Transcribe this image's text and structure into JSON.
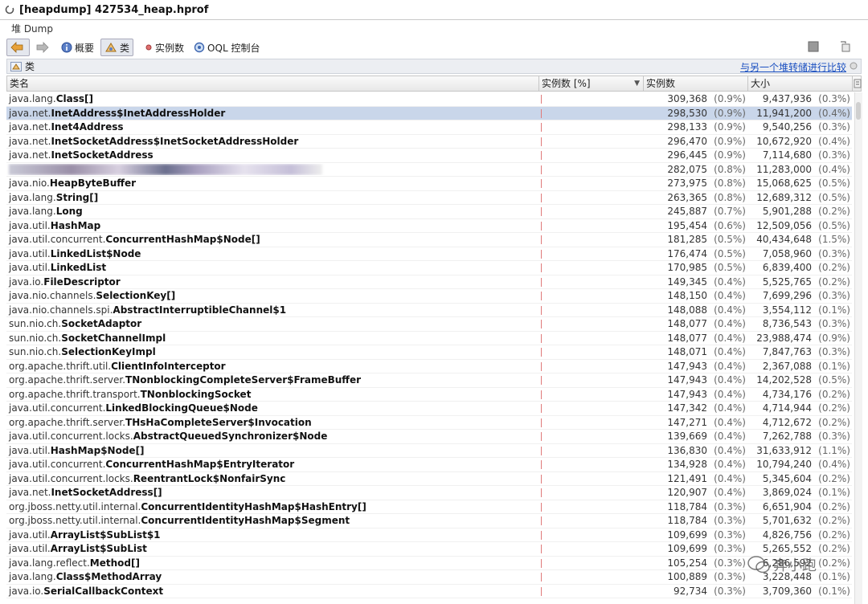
{
  "window": {
    "title": "[heapdump] 427534_heap.hprof"
  },
  "subtab": {
    "label": "堆 Dump"
  },
  "toolbar": {
    "summary_label": "概要",
    "classes_label": "类",
    "instances_label": "实例数",
    "oql_label": "OQL 控制台"
  },
  "section": {
    "title": "类",
    "compare_link": "与另一个堆转储进行比较"
  },
  "columns": {
    "name": "类名",
    "instances_pct": "实例数 [%]",
    "instances": "实例数",
    "size": "大小"
  },
  "watermark": {
    "text": "奔小跑"
  },
  "rows": [
    {
      "pkg": "java.lang.",
      "cls": "Class[]",
      "count": "309,368",
      "cpct": "(0.9%)",
      "size": "9,437,936",
      "spct": "(0.3%)"
    },
    {
      "pkg": "java.net.",
      "cls": "InetAddress$InetAddressHolder",
      "count": "298,530",
      "cpct": "(0.9%)",
      "size": "11,941,200",
      "spct": "(0.4%)",
      "selected": true
    },
    {
      "pkg": "java.net.",
      "cls": "Inet4Address",
      "count": "298,133",
      "cpct": "(0.9%)",
      "size": "9,540,256",
      "spct": "(0.3%)"
    },
    {
      "pkg": "java.net.",
      "cls": "InetSocketAddress$InetSocketAddressHolder",
      "count": "296,470",
      "cpct": "(0.9%)",
      "size": "10,672,920",
      "spct": "(0.4%)"
    },
    {
      "pkg": "java.net.",
      "cls": "InetSocketAddress",
      "count": "296,445",
      "cpct": "(0.9%)",
      "size": "7,114,680",
      "spct": "(0.3%)"
    },
    {
      "pkg": "",
      "cls": "",
      "count": "282,075",
      "cpct": "(0.8%)",
      "size": "11,283,000",
      "spct": "(0.4%)",
      "blurred": true
    },
    {
      "pkg": "java.nio.",
      "cls": "HeapByteBuffer",
      "count": "273,975",
      "cpct": "(0.8%)",
      "size": "15,068,625",
      "spct": "(0.5%)"
    },
    {
      "pkg": "java.lang.",
      "cls": "String[]",
      "count": "263,365",
      "cpct": "(0.8%)",
      "size": "12,689,312",
      "spct": "(0.5%)"
    },
    {
      "pkg": "java.lang.",
      "cls": "Long",
      "count": "245,887",
      "cpct": "(0.7%)",
      "size": "5,901,288",
      "spct": "(0.2%)"
    },
    {
      "pkg": "java.util.",
      "cls": "HashMap",
      "count": "195,454",
      "cpct": "(0.6%)",
      "size": "12,509,056",
      "spct": "(0.5%)"
    },
    {
      "pkg": "java.util.concurrent.",
      "cls": "ConcurrentHashMap$Node[]",
      "count": "181,285",
      "cpct": "(0.5%)",
      "size": "40,434,648",
      "spct": "(1.5%)"
    },
    {
      "pkg": "java.util.",
      "cls": "LinkedList$Node",
      "count": "176,474",
      "cpct": "(0.5%)",
      "size": "7,058,960",
      "spct": "(0.3%)"
    },
    {
      "pkg": "java.util.",
      "cls": "LinkedList",
      "count": "170,985",
      "cpct": "(0.5%)",
      "size": "6,839,400",
      "spct": "(0.2%)"
    },
    {
      "pkg": "java.io.",
      "cls": "FileDescriptor",
      "count": "149,345",
      "cpct": "(0.4%)",
      "size": "5,525,765",
      "spct": "(0.2%)"
    },
    {
      "pkg": "java.nio.channels.",
      "cls": "SelectionKey[]",
      "count": "148,150",
      "cpct": "(0.4%)",
      "size": "7,699,296",
      "spct": "(0.3%)"
    },
    {
      "pkg": "java.nio.channels.spi.",
      "cls": "AbstractInterruptibleChannel$1",
      "count": "148,088",
      "cpct": "(0.4%)",
      "size": "3,554,112",
      "spct": "(0.1%)"
    },
    {
      "pkg": "sun.nio.ch.",
      "cls": "SocketAdaptor",
      "count": "148,077",
      "cpct": "(0.4%)",
      "size": "8,736,543",
      "spct": "(0.3%)"
    },
    {
      "pkg": "sun.nio.ch.",
      "cls": "SocketChannelImpl",
      "count": "148,077",
      "cpct": "(0.4%)",
      "size": "23,988,474",
      "spct": "(0.9%)"
    },
    {
      "pkg": "sun.nio.ch.",
      "cls": "SelectionKeyImpl",
      "count": "148,071",
      "cpct": "(0.4%)",
      "size": "7,847,763",
      "spct": "(0.3%)"
    },
    {
      "pkg": "org.apache.thrift.util.",
      "cls": "ClientInfoInterceptor",
      "count": "147,943",
      "cpct": "(0.4%)",
      "size": "2,367,088",
      "spct": "(0.1%)"
    },
    {
      "pkg": "org.apache.thrift.server.",
      "cls": "TNonblockingCompleteServer$FrameBuffer",
      "count": "147,943",
      "cpct": "(0.4%)",
      "size": "14,202,528",
      "spct": "(0.5%)"
    },
    {
      "pkg": "org.apache.thrift.transport.",
      "cls": "TNonblockingSocket",
      "count": "147,943",
      "cpct": "(0.4%)",
      "size": "4,734,176",
      "spct": "(0.2%)"
    },
    {
      "pkg": "java.util.concurrent.",
      "cls": "LinkedBlockingQueue$Node",
      "count": "147,342",
      "cpct": "(0.4%)",
      "size": "4,714,944",
      "spct": "(0.2%)"
    },
    {
      "pkg": "org.apache.thrift.server.",
      "cls": "THsHaCompleteServer$Invocation",
      "count": "147,271",
      "cpct": "(0.4%)",
      "size": "4,712,672",
      "spct": "(0.2%)"
    },
    {
      "pkg": "java.util.concurrent.locks.",
      "cls": "AbstractQueuedSynchronizer$Node",
      "count": "139,669",
      "cpct": "(0.4%)",
      "size": "7,262,788",
      "spct": "(0.3%)"
    },
    {
      "pkg": "java.util.",
      "cls": "HashMap$Node[]",
      "count": "136,830",
      "cpct": "(0.4%)",
      "size": "31,633,912",
      "spct": "(1.1%)"
    },
    {
      "pkg": "java.util.concurrent.",
      "cls": "ConcurrentHashMap$EntryIterator",
      "count": "134,928",
      "cpct": "(0.4%)",
      "size": "10,794,240",
      "spct": "(0.4%)"
    },
    {
      "pkg": "java.util.concurrent.locks.",
      "cls": "ReentrantLock$NonfairSync",
      "count": "121,491",
      "cpct": "(0.4%)",
      "size": "5,345,604",
      "spct": "(0.2%)"
    },
    {
      "pkg": "java.net.",
      "cls": "InetSocketAddress[]",
      "count": "120,907",
      "cpct": "(0.4%)",
      "size": "3,869,024",
      "spct": "(0.1%)"
    },
    {
      "pkg": "org.jboss.netty.util.internal.",
      "cls": "ConcurrentIdentityHashMap$HashEntry[]",
      "count": "118,784",
      "cpct": "(0.3%)",
      "size": "6,651,904",
      "spct": "(0.2%)"
    },
    {
      "pkg": "org.jboss.netty.util.internal.",
      "cls": "ConcurrentIdentityHashMap$Segment",
      "count": "118,784",
      "cpct": "(0.3%)",
      "size": "5,701,632",
      "spct": "(0.2%)"
    },
    {
      "pkg": "java.util.",
      "cls": "ArrayList$SubList$1",
      "count": "109,699",
      "cpct": "(0.3%)",
      "size": "4,826,756",
      "spct": "(0.2%)"
    },
    {
      "pkg": "java.util.",
      "cls": "ArrayList$SubList",
      "count": "109,699",
      "cpct": "(0.3%)",
      "size": "5,265,552",
      "spct": "(0.2%)"
    },
    {
      "pkg": "java.lang.reflect.",
      "cls": "Method[]",
      "count": "105,254",
      "cpct": "(0.3%)",
      "size": "6,286,592",
      "spct": "(0.2%)"
    },
    {
      "pkg": "java.lang.",
      "cls": "Class$MethodArray",
      "count": "100,889",
      "cpct": "(0.3%)",
      "size": "3,228,448",
      "spct": "(0.1%)"
    },
    {
      "pkg": "java.io.",
      "cls": "SerialCallbackContext",
      "count": "92,734",
      "cpct": "(0.3%)",
      "size": "3,709,360",
      "spct": "(0.1%)"
    }
  ]
}
